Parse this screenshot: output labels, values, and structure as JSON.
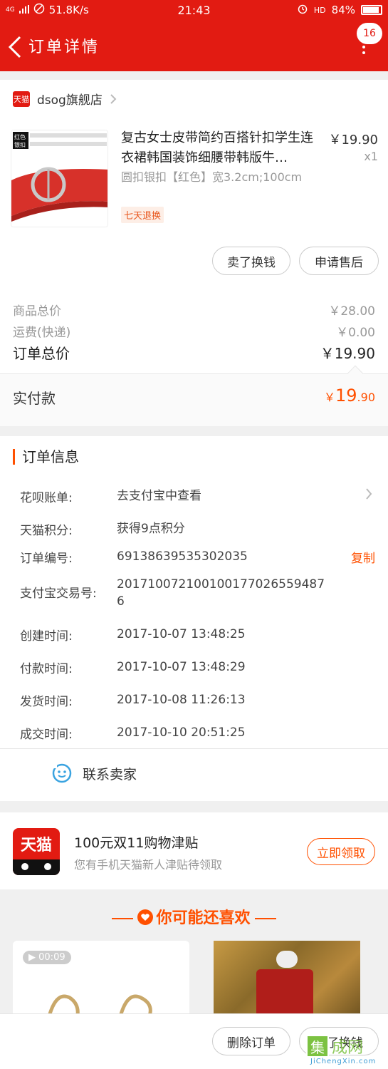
{
  "status_bar": {
    "network": "4G",
    "speed": "51.8K/s",
    "time": "21:43",
    "hd": "HD",
    "battery": "84%"
  },
  "nav": {
    "title": "订单详情",
    "badge_count": "16"
  },
  "store": {
    "logo_text": "天猫",
    "name": "dsog旗舰店"
  },
  "product": {
    "title": "复古女士皮带简约百搭针扣学生连衣裙韩国装饰细腰带韩版牛…",
    "price": "￥19.90",
    "qty": "x1",
    "sku": "圆扣银扣【红色】宽3.2cm;100cm",
    "tag": "七天退换",
    "img_label_1": "红色",
    "img_label_2": "银扣"
  },
  "actions": {
    "sell": "卖了换钱",
    "aftersale": "申请售后"
  },
  "prices": {
    "goods_label": "商品总价",
    "goods_value": "￥28.00",
    "ship_label": "运费(快递)",
    "ship_value": "￥0.00",
    "total_label": "订单总价",
    "total_value": "￥19.90",
    "paid_label": "实付款",
    "paid_currency": "￥",
    "paid_int": "19",
    "paid_dec": ".90"
  },
  "order_info": {
    "title": "订单信息",
    "rows": [
      {
        "label": "花呗账单:",
        "value": "去支付宝中查看"
      },
      {
        "label": "天猫积分:",
        "value": "获得9点积分"
      },
      {
        "label": "订单编号:",
        "value": "69138639535302035"
      },
      {
        "label": "支付宝交易号:",
        "value": "2017100721001001770265594876"
      },
      {
        "label": "创建时间:",
        "value": "2017-10-07 13:48:25"
      },
      {
        "label": "付款时间:",
        "value": "2017-10-07 13:48:29"
      },
      {
        "label": "发货时间:",
        "value": "2017-10-08 11:26:13"
      },
      {
        "label": "成交时间:",
        "value": "2017-10-10 20:51:25"
      }
    ],
    "copy": "复制",
    "contact": "联系卖家"
  },
  "promo": {
    "logo": "天猫",
    "title": "100元双11购物津贴",
    "subtitle": "您有手机天猫新人津贴待领取",
    "button": "立即领取"
  },
  "recommend": {
    "title": "你可能还喜欢",
    "video_duration": "00:09"
  },
  "bottom": {
    "delete": "删除订单",
    "sell": "卖了换钱"
  },
  "watermark": {
    "logo": "集",
    "cn": "成网",
    "en": "JiChengXin.com"
  },
  "colors": {
    "brand_red": "#e21b12",
    "accent_orange": "#ff5000"
  }
}
